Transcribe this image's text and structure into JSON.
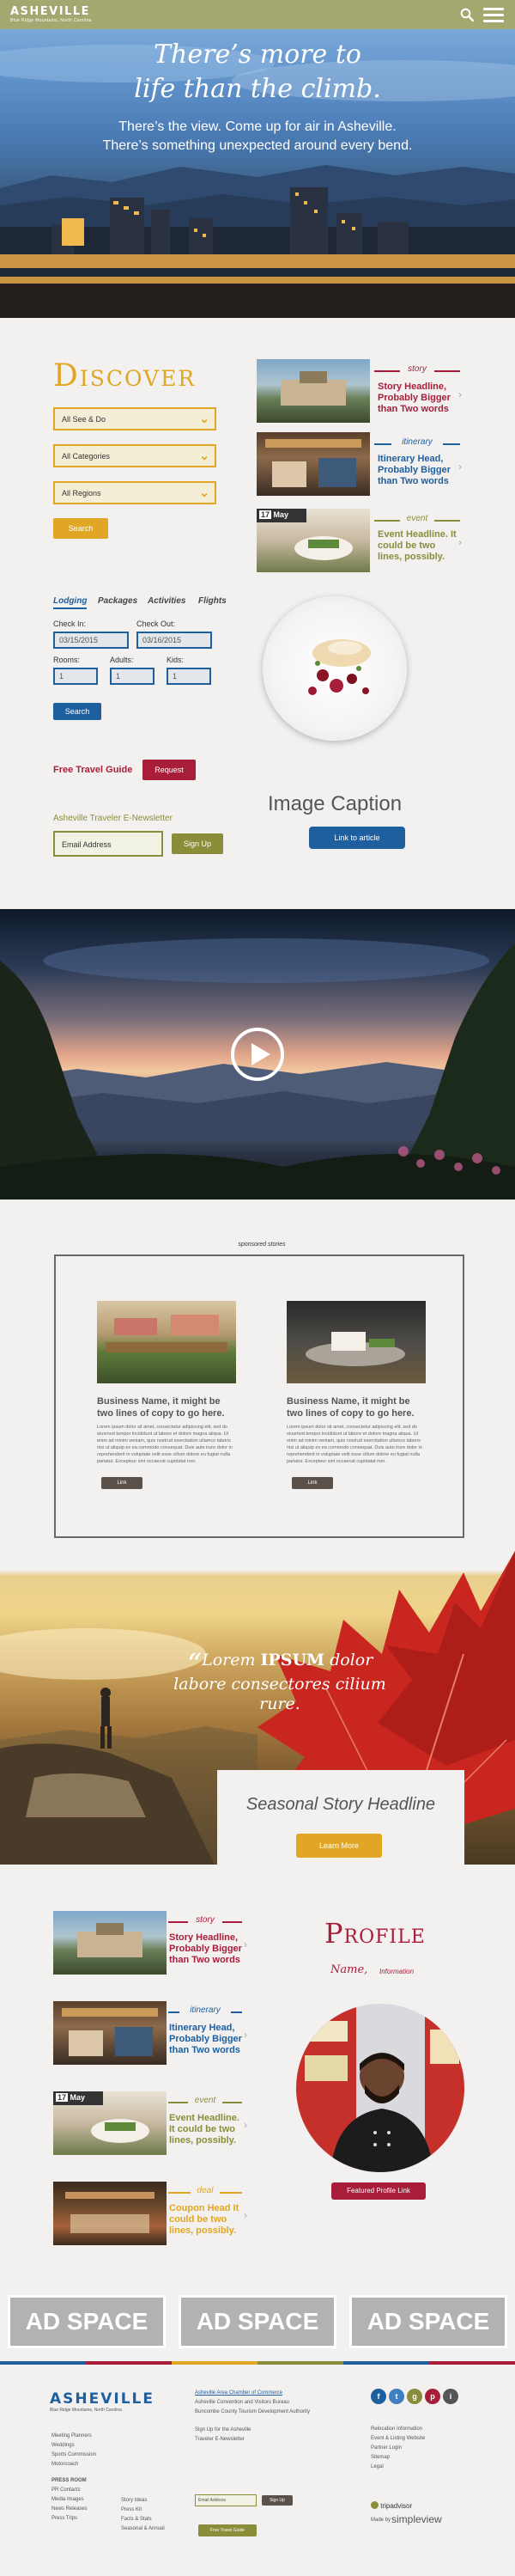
{
  "header": {
    "logo": "ASHEVILLE",
    "logo_tagline": "Blue Ridge Mountains, North Carolina"
  },
  "hero": {
    "title_line1": "There’s more to",
    "title_line2": "life than the climb.",
    "sub_line1": "There’s the view. Come up for air in Asheville.",
    "sub_line2": "There’s something unexpected around every bend."
  },
  "discover": {
    "heading": "Discover",
    "dropdowns": [
      "All See & Do",
      "All Categories",
      "All Regions"
    ],
    "search_label": "Search"
  },
  "stories": [
    {
      "category": "story",
      "title": "Story Headline, Probably Bigger than Two words",
      "color": "#a81d3a"
    },
    {
      "category": "itinerary",
      "title": "Itinerary Head, Probably Bigger than Two words",
      "color": "#1e5fa0"
    },
    {
      "category": "event",
      "title": "Event Headline. It could be two lines, possibly.",
      "color": "#8a8d3a",
      "date_num": "17",
      "date_month": "May"
    }
  ],
  "booking": {
    "tabs": [
      "Lodging",
      "Packages",
      "Activities",
      "Flights"
    ],
    "checkin_label": "Check In:",
    "checkin_value": "03/15/2015",
    "checkout_label": "Check Out:",
    "checkout_value": "03/16/2015",
    "rooms_label": "Rooms:",
    "rooms_value": "1",
    "adults_label": "Adults:",
    "adults_value": "1",
    "kids_label": "Kids:",
    "kids_value": "1",
    "search_label": "Search"
  },
  "guide": {
    "text": "Free Travel Guide",
    "button": "Request"
  },
  "newsletter": {
    "title": "Asheville Traveler E-Newsletter",
    "placeholder": "Email Address",
    "button": "Sign Up"
  },
  "feature": {
    "caption": "Image Caption",
    "button": "Link to article"
  },
  "sponsored": {
    "label": "sponsored stories",
    "items": [
      {
        "headline": "Business Name, it might be two lines of copy to go here.",
        "body": "Lorem ipsum dolor sit amet, consectetur adipiscing elit, sed do eiusmod tempor incididunt ut labore et dolore magna aliqua. Ut enim ad minim veniam, quis nostrud exercitation ullamco laboris nisi ut aliquip ex ea commodo consequat. Duis aute irure dolor in reprehenderit in voluptate velit esse cillum dolore eu fugiat nulla pariatur. Excepteur sint occaecat cupidatat non.",
        "button": "Link"
      },
      {
        "headline": "Business Name, it might be two lines of copy to go here.",
        "body": "Lorem ipsum dolor sit amet, consectetur adipiscing elit, sed do eiusmod tempor incididunt ut labore et dolore magna aliqua. Ut enim ad minim veniam, quis nostrud exercitation ullamco laboris nisi ut aliquip ex ea commodo consequat. Duis aute irure dolor in reprehenderit in voluptate velit esse cillum dolore eu fugiat nulla pariatur. Excepteur sint occaecat cupidatat non.",
        "button": "Link"
      }
    ]
  },
  "seasonal": {
    "quote_open": "“",
    "quote_pre": "Lorem ",
    "quote_bold": "IPSUM",
    "quote_post": " dolor labore consectores cilium rure.",
    "headline": "Seasonal Story Headline",
    "button": "Learn More"
  },
  "stories2": [
    {
      "category": "story",
      "title": "Story Headline, Probably Bigger than Two words",
      "color": "#a81d3a"
    },
    {
      "category": "itinerary",
      "title": "Itinerary Head, Probably Bigger than Two words",
      "color": "#1e5fa0"
    },
    {
      "category": "event",
      "title": "Event Headline. It could be two lines, possibly.",
      "color": "#8a8d3a",
      "date_num": "17",
      "date_month": "May"
    },
    {
      "category": "deal",
      "title": "Coupon Head It could be two lines, possibly.",
      "color": "#e0a624"
    }
  ],
  "profile": {
    "heading": "Profile",
    "name": "Name,",
    "info": "Information",
    "button": "Featured Profile Link"
  },
  "ads": [
    "AD SPACE",
    "AD SPACE",
    "AD SPACE"
  ],
  "stripe_colors": [
    "#1e5fa0",
    "#a81d3a",
    "#e0a624",
    "#8a8d3a",
    "#1e5fa0",
    "#a81d3a"
  ],
  "footer": {
    "logo": "ASHEVILLE",
    "logo_tagline": "Blue Ridge Mountains, North Carolina",
    "col1": [
      "Meeting Planners",
      "Weddings",
      "Sports Commission",
      "Motorcoach"
    ],
    "col1_head2": "PRESS ROOM",
    "col1b": [
      "PR Contacts",
      "Media Images",
      "News Releases",
      "Press Trips"
    ],
    "col2": [
      "Story Ideas",
      "Press Kit",
      "Facts & Stats",
      "Seasonal & Annual"
    ],
    "org": "Asheville Area Chamber of Commerce",
    "org_links": [
      "Asheville Convention and Visitors Bureau",
      "Buncombe County Tourism Development Authority"
    ],
    "signup_head": "Sign Up for the Asheville",
    "signup_sub": "Traveler E-Newsletter",
    "email_placeholder": "Email Address",
    "signup_button": "Sign Up",
    "guide_button": "Free Travel Guide",
    "col4": [
      "Relocation Information",
      "Event & Listing Website",
      "Partner Login",
      "Sitemap",
      "Legal"
    ],
    "social": [
      "f",
      "t",
      "g",
      "p",
      "i"
    ],
    "social_colors": [
      "#1e5fa0",
      "#3e7fbf",
      "#8a8d3a",
      "#a81d3a",
      "#555555"
    ],
    "tripadvisor": "tripadvisor",
    "made_by": "Made by",
    "simpleview": "simpleview"
  }
}
